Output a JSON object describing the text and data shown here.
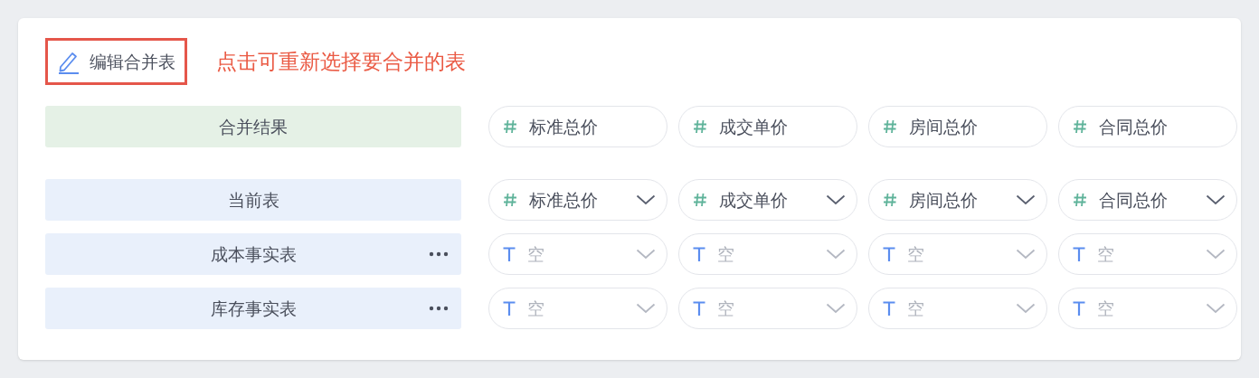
{
  "edit_button": {
    "label": "编辑合并表",
    "highlighted": true
  },
  "annotation": "点击可重新选择要合并的表",
  "result_row": {
    "label": "合并结果",
    "fields": [
      {
        "kind": "number",
        "name": "标准总价"
      },
      {
        "kind": "number",
        "name": "成交单价"
      },
      {
        "kind": "number",
        "name": "房间总价"
      },
      {
        "kind": "number",
        "name": "合同总价"
      }
    ]
  },
  "table_rows": [
    {
      "label": "当前表",
      "more_menu": false,
      "fields": [
        {
          "kind": "number",
          "value": "标准总价"
        },
        {
          "kind": "number",
          "value": "成交单价"
        },
        {
          "kind": "number",
          "value": "房间总价"
        },
        {
          "kind": "number",
          "value": "合同总价"
        }
      ]
    },
    {
      "label": "成本事实表",
      "more_menu": true,
      "fields": [
        {
          "kind": "text",
          "placeholder": "空"
        },
        {
          "kind": "text",
          "placeholder": "空"
        },
        {
          "kind": "text",
          "placeholder": "空"
        },
        {
          "kind": "text",
          "placeholder": "空"
        }
      ]
    },
    {
      "label": "库存事实表",
      "more_menu": true,
      "fields": [
        {
          "kind": "text",
          "placeholder": "空"
        },
        {
          "kind": "text",
          "placeholder": "空"
        },
        {
          "kind": "text",
          "placeholder": "空"
        },
        {
          "kind": "text",
          "placeholder": "空"
        }
      ]
    }
  ]
}
